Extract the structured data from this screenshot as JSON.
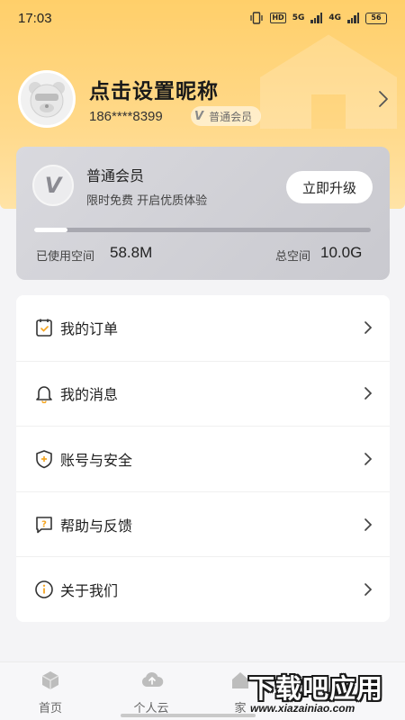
{
  "status_bar": {
    "time": "17:03",
    "hd_label": "HD",
    "net_5g": "5G",
    "net_4g": "4G",
    "battery": "56"
  },
  "profile": {
    "nickname": "点击设置昵称",
    "phone": "186****8399",
    "member_tag_icon": "V",
    "member_tag": "普通会员"
  },
  "vip_card": {
    "badge_icon": "V",
    "title": "普通会员",
    "subtitle": "限时免费 开启优质体验",
    "upgrade_label": "立即升级",
    "storage_used_fraction": 0.1,
    "used_label": "已使用空间",
    "used_value": "58.8M",
    "total_label": "总空间",
    "total_value": "10.0G"
  },
  "menu": {
    "items": [
      {
        "label": "我的订单",
        "icon": "order-icon"
      },
      {
        "label": "我的消息",
        "icon": "bell-icon"
      },
      {
        "label": "账号与安全",
        "icon": "shield-icon"
      },
      {
        "label": "帮助与反馈",
        "icon": "help-icon"
      },
      {
        "label": "关于我们",
        "icon": "info-icon"
      }
    ]
  },
  "bottom_nav": {
    "items": [
      {
        "label": "首页",
        "icon": "box-icon"
      },
      {
        "label": "个人云",
        "icon": "cloud-upload-icon"
      },
      {
        "label": "家",
        "icon": "home-icon"
      }
    ]
  },
  "watermark": {
    "main": "下载吧应用",
    "url": "www.xiazainiao.com"
  },
  "colors": {
    "hero": "#ffd27a",
    "card": "#d3d3d8",
    "accent_text": "#1a1a1a"
  }
}
